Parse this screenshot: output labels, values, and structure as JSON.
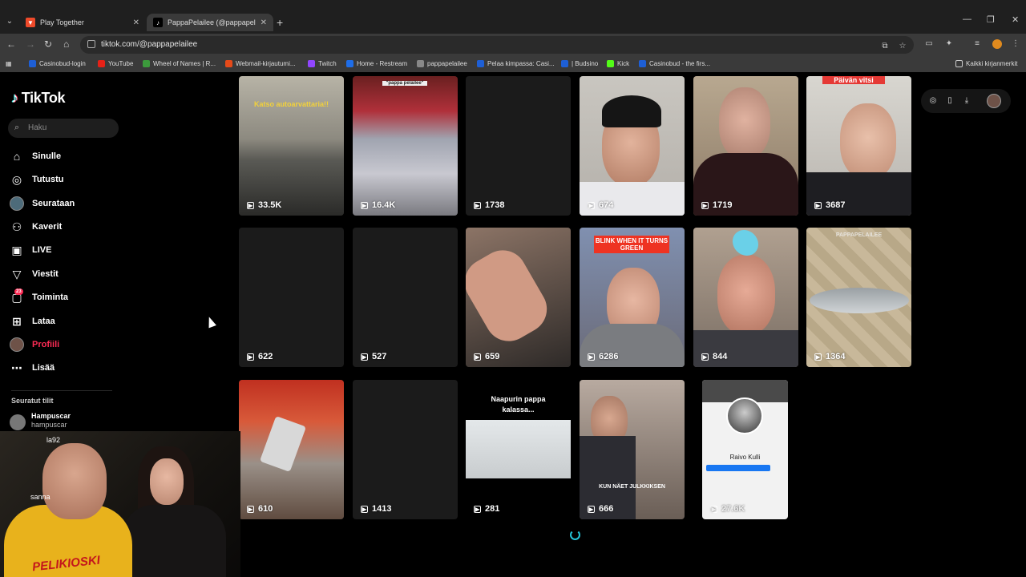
{
  "browser": {
    "tabs": [
      {
        "title": "Play Together",
        "active": false
      },
      {
        "title": "PappaPelailee (@pappapelailee)",
        "active": true
      }
    ],
    "url": "tiktok.com/@pappapelailee",
    "bookmarks": [
      {
        "label": "Casinobud-login",
        "color": "#1e5fd6"
      },
      {
        "label": "YouTube",
        "color": "#e62117"
      },
      {
        "label": "Wheel of Names | R...",
        "color": "#3c9a3c"
      },
      {
        "label": "Webmail-kirjautumi...",
        "color": "#e64a19"
      },
      {
        "label": "Twitch",
        "color": "#9146ff"
      },
      {
        "label": "Home - Restream",
        "color": "#1e6de8"
      },
      {
        "label": "pappapelailee",
        "color": "#888888"
      },
      {
        "label": "Pelaa kimpassa: Casi...",
        "color": "#1e5fd6"
      },
      {
        "label": "| Budsino",
        "color": "#1e5fd6"
      },
      {
        "label": "Kick",
        "color": "#53fc18"
      },
      {
        "label": "Casinobud - the firs...",
        "color": "#1e5fd6"
      }
    ],
    "bookmarks_all": "Kaikki kirjanmerkit"
  },
  "tiktok": {
    "logo": "TikTok",
    "search_placeholder": "Haku",
    "nav": [
      {
        "label": "Sinulle",
        "icon": "home-icon",
        "active": false
      },
      {
        "label": "Tutustu",
        "icon": "compass-icon",
        "active": false
      },
      {
        "label": "Seurataan",
        "icon": "avatar-icon",
        "active": false
      },
      {
        "label": "Kaverit",
        "icon": "friends-icon",
        "active": false
      },
      {
        "label": "LIVE",
        "icon": "live-icon",
        "active": false
      },
      {
        "label": "Viestit",
        "icon": "messages-icon",
        "active": false
      },
      {
        "label": "Toiminta",
        "icon": "activity-icon",
        "active": false,
        "badge": "23"
      },
      {
        "label": "Lataa",
        "icon": "upload-icon",
        "active": false
      },
      {
        "label": "Profiili",
        "icon": "profile-avatar-icon",
        "active": true
      },
      {
        "label": "Lisää",
        "icon": "more-icon",
        "active": false
      }
    ],
    "following_title": "Seuratut tilit",
    "following": [
      {
        "name": "Hampuscar",
        "handle": "hampuscar"
      }
    ],
    "partial_texts": [
      "la92",
      "sanna"
    ],
    "webcam_shirt_text": "PELIKIOSKI",
    "videos": [
      {
        "views": "33.5K",
        "caption": "Katso autoarvattaria!!"
      },
      {
        "views": "16.4K",
        "caption": "\"pappa pelailee\""
      },
      {
        "views": "1738"
      },
      {
        "views": "674"
      },
      {
        "views": "1719"
      },
      {
        "views": "3687",
        "caption": "Päivän vitsi"
      },
      {
        "views": "622"
      },
      {
        "views": "527"
      },
      {
        "views": "659"
      },
      {
        "views": "6286",
        "caption": "BLINK WHEN IT TURNS GREEN"
      },
      {
        "views": "844"
      },
      {
        "views": "1364",
        "caption": "PAPPAPELAILEE"
      },
      {
        "views": "610"
      },
      {
        "views": "1413"
      },
      {
        "views": "281",
        "caption": "Naapurin pappa kalassa..."
      },
      {
        "views": "666",
        "caption": "KUN NÄET JULKKIKSEN"
      },
      {
        "views": "27.6K",
        "caption": "Raivo Kulli"
      }
    ]
  }
}
